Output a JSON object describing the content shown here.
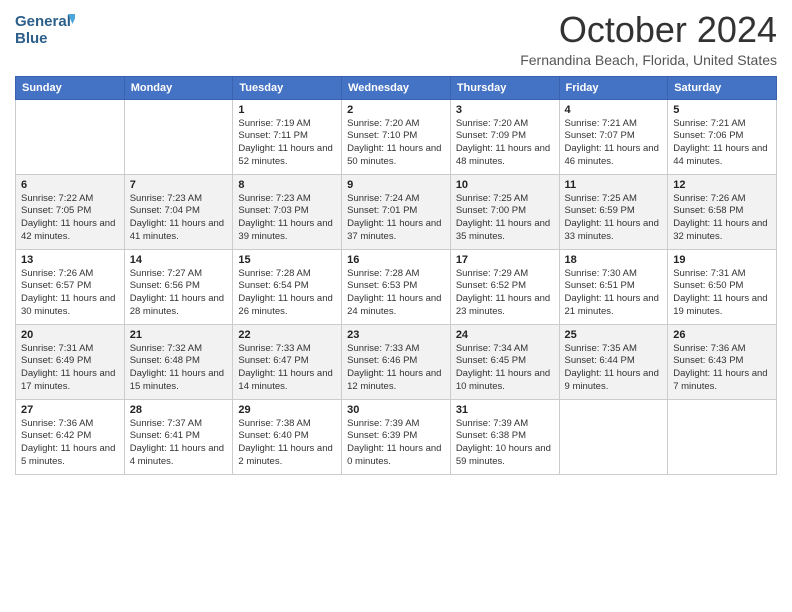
{
  "logo": {
    "line1": "General",
    "line2": "Blue"
  },
  "title": "October 2024",
  "location": "Fernandina Beach, Florida, United States",
  "days_of_week": [
    "Sunday",
    "Monday",
    "Tuesday",
    "Wednesday",
    "Thursday",
    "Friday",
    "Saturday"
  ],
  "weeks": [
    [
      {
        "day": "",
        "sunrise": "",
        "sunset": "",
        "daylight": ""
      },
      {
        "day": "",
        "sunrise": "",
        "sunset": "",
        "daylight": ""
      },
      {
        "day": "1",
        "sunrise": "Sunrise: 7:19 AM",
        "sunset": "Sunset: 7:11 PM",
        "daylight": "Daylight: 11 hours and 52 minutes."
      },
      {
        "day": "2",
        "sunrise": "Sunrise: 7:20 AM",
        "sunset": "Sunset: 7:10 PM",
        "daylight": "Daylight: 11 hours and 50 minutes."
      },
      {
        "day": "3",
        "sunrise": "Sunrise: 7:20 AM",
        "sunset": "Sunset: 7:09 PM",
        "daylight": "Daylight: 11 hours and 48 minutes."
      },
      {
        "day": "4",
        "sunrise": "Sunrise: 7:21 AM",
        "sunset": "Sunset: 7:07 PM",
        "daylight": "Daylight: 11 hours and 46 minutes."
      },
      {
        "day": "5",
        "sunrise": "Sunrise: 7:21 AM",
        "sunset": "Sunset: 7:06 PM",
        "daylight": "Daylight: 11 hours and 44 minutes."
      }
    ],
    [
      {
        "day": "6",
        "sunrise": "Sunrise: 7:22 AM",
        "sunset": "Sunset: 7:05 PM",
        "daylight": "Daylight: 11 hours and 42 minutes."
      },
      {
        "day": "7",
        "sunrise": "Sunrise: 7:23 AM",
        "sunset": "Sunset: 7:04 PM",
        "daylight": "Daylight: 11 hours and 41 minutes."
      },
      {
        "day": "8",
        "sunrise": "Sunrise: 7:23 AM",
        "sunset": "Sunset: 7:03 PM",
        "daylight": "Daylight: 11 hours and 39 minutes."
      },
      {
        "day": "9",
        "sunrise": "Sunrise: 7:24 AM",
        "sunset": "Sunset: 7:01 PM",
        "daylight": "Daylight: 11 hours and 37 minutes."
      },
      {
        "day": "10",
        "sunrise": "Sunrise: 7:25 AM",
        "sunset": "Sunset: 7:00 PM",
        "daylight": "Daylight: 11 hours and 35 minutes."
      },
      {
        "day": "11",
        "sunrise": "Sunrise: 7:25 AM",
        "sunset": "Sunset: 6:59 PM",
        "daylight": "Daylight: 11 hours and 33 minutes."
      },
      {
        "day": "12",
        "sunrise": "Sunrise: 7:26 AM",
        "sunset": "Sunset: 6:58 PM",
        "daylight": "Daylight: 11 hours and 32 minutes."
      }
    ],
    [
      {
        "day": "13",
        "sunrise": "Sunrise: 7:26 AM",
        "sunset": "Sunset: 6:57 PM",
        "daylight": "Daylight: 11 hours and 30 minutes."
      },
      {
        "day": "14",
        "sunrise": "Sunrise: 7:27 AM",
        "sunset": "Sunset: 6:56 PM",
        "daylight": "Daylight: 11 hours and 28 minutes."
      },
      {
        "day": "15",
        "sunrise": "Sunrise: 7:28 AM",
        "sunset": "Sunset: 6:54 PM",
        "daylight": "Daylight: 11 hours and 26 minutes."
      },
      {
        "day": "16",
        "sunrise": "Sunrise: 7:28 AM",
        "sunset": "Sunset: 6:53 PM",
        "daylight": "Daylight: 11 hours and 24 minutes."
      },
      {
        "day": "17",
        "sunrise": "Sunrise: 7:29 AM",
        "sunset": "Sunset: 6:52 PM",
        "daylight": "Daylight: 11 hours and 23 minutes."
      },
      {
        "day": "18",
        "sunrise": "Sunrise: 7:30 AM",
        "sunset": "Sunset: 6:51 PM",
        "daylight": "Daylight: 11 hours and 21 minutes."
      },
      {
        "day": "19",
        "sunrise": "Sunrise: 7:31 AM",
        "sunset": "Sunset: 6:50 PM",
        "daylight": "Daylight: 11 hours and 19 minutes."
      }
    ],
    [
      {
        "day": "20",
        "sunrise": "Sunrise: 7:31 AM",
        "sunset": "Sunset: 6:49 PM",
        "daylight": "Daylight: 11 hours and 17 minutes."
      },
      {
        "day": "21",
        "sunrise": "Sunrise: 7:32 AM",
        "sunset": "Sunset: 6:48 PM",
        "daylight": "Daylight: 11 hours and 15 minutes."
      },
      {
        "day": "22",
        "sunrise": "Sunrise: 7:33 AM",
        "sunset": "Sunset: 6:47 PM",
        "daylight": "Daylight: 11 hours and 14 minutes."
      },
      {
        "day": "23",
        "sunrise": "Sunrise: 7:33 AM",
        "sunset": "Sunset: 6:46 PM",
        "daylight": "Daylight: 11 hours and 12 minutes."
      },
      {
        "day": "24",
        "sunrise": "Sunrise: 7:34 AM",
        "sunset": "Sunset: 6:45 PM",
        "daylight": "Daylight: 11 hours and 10 minutes."
      },
      {
        "day": "25",
        "sunrise": "Sunrise: 7:35 AM",
        "sunset": "Sunset: 6:44 PM",
        "daylight": "Daylight: 11 hours and 9 minutes."
      },
      {
        "day": "26",
        "sunrise": "Sunrise: 7:36 AM",
        "sunset": "Sunset: 6:43 PM",
        "daylight": "Daylight: 11 hours and 7 minutes."
      }
    ],
    [
      {
        "day": "27",
        "sunrise": "Sunrise: 7:36 AM",
        "sunset": "Sunset: 6:42 PM",
        "daylight": "Daylight: 11 hours and 5 minutes."
      },
      {
        "day": "28",
        "sunrise": "Sunrise: 7:37 AM",
        "sunset": "Sunset: 6:41 PM",
        "daylight": "Daylight: 11 hours and 4 minutes."
      },
      {
        "day": "29",
        "sunrise": "Sunrise: 7:38 AM",
        "sunset": "Sunset: 6:40 PM",
        "daylight": "Daylight: 11 hours and 2 minutes."
      },
      {
        "day": "30",
        "sunrise": "Sunrise: 7:39 AM",
        "sunset": "Sunset: 6:39 PM",
        "daylight": "Daylight: 11 hours and 0 minutes."
      },
      {
        "day": "31",
        "sunrise": "Sunrise: 7:39 AM",
        "sunset": "Sunset: 6:38 PM",
        "daylight": "Daylight: 10 hours and 59 minutes."
      },
      {
        "day": "",
        "sunrise": "",
        "sunset": "",
        "daylight": ""
      },
      {
        "day": "",
        "sunrise": "",
        "sunset": "",
        "daylight": ""
      }
    ]
  ]
}
